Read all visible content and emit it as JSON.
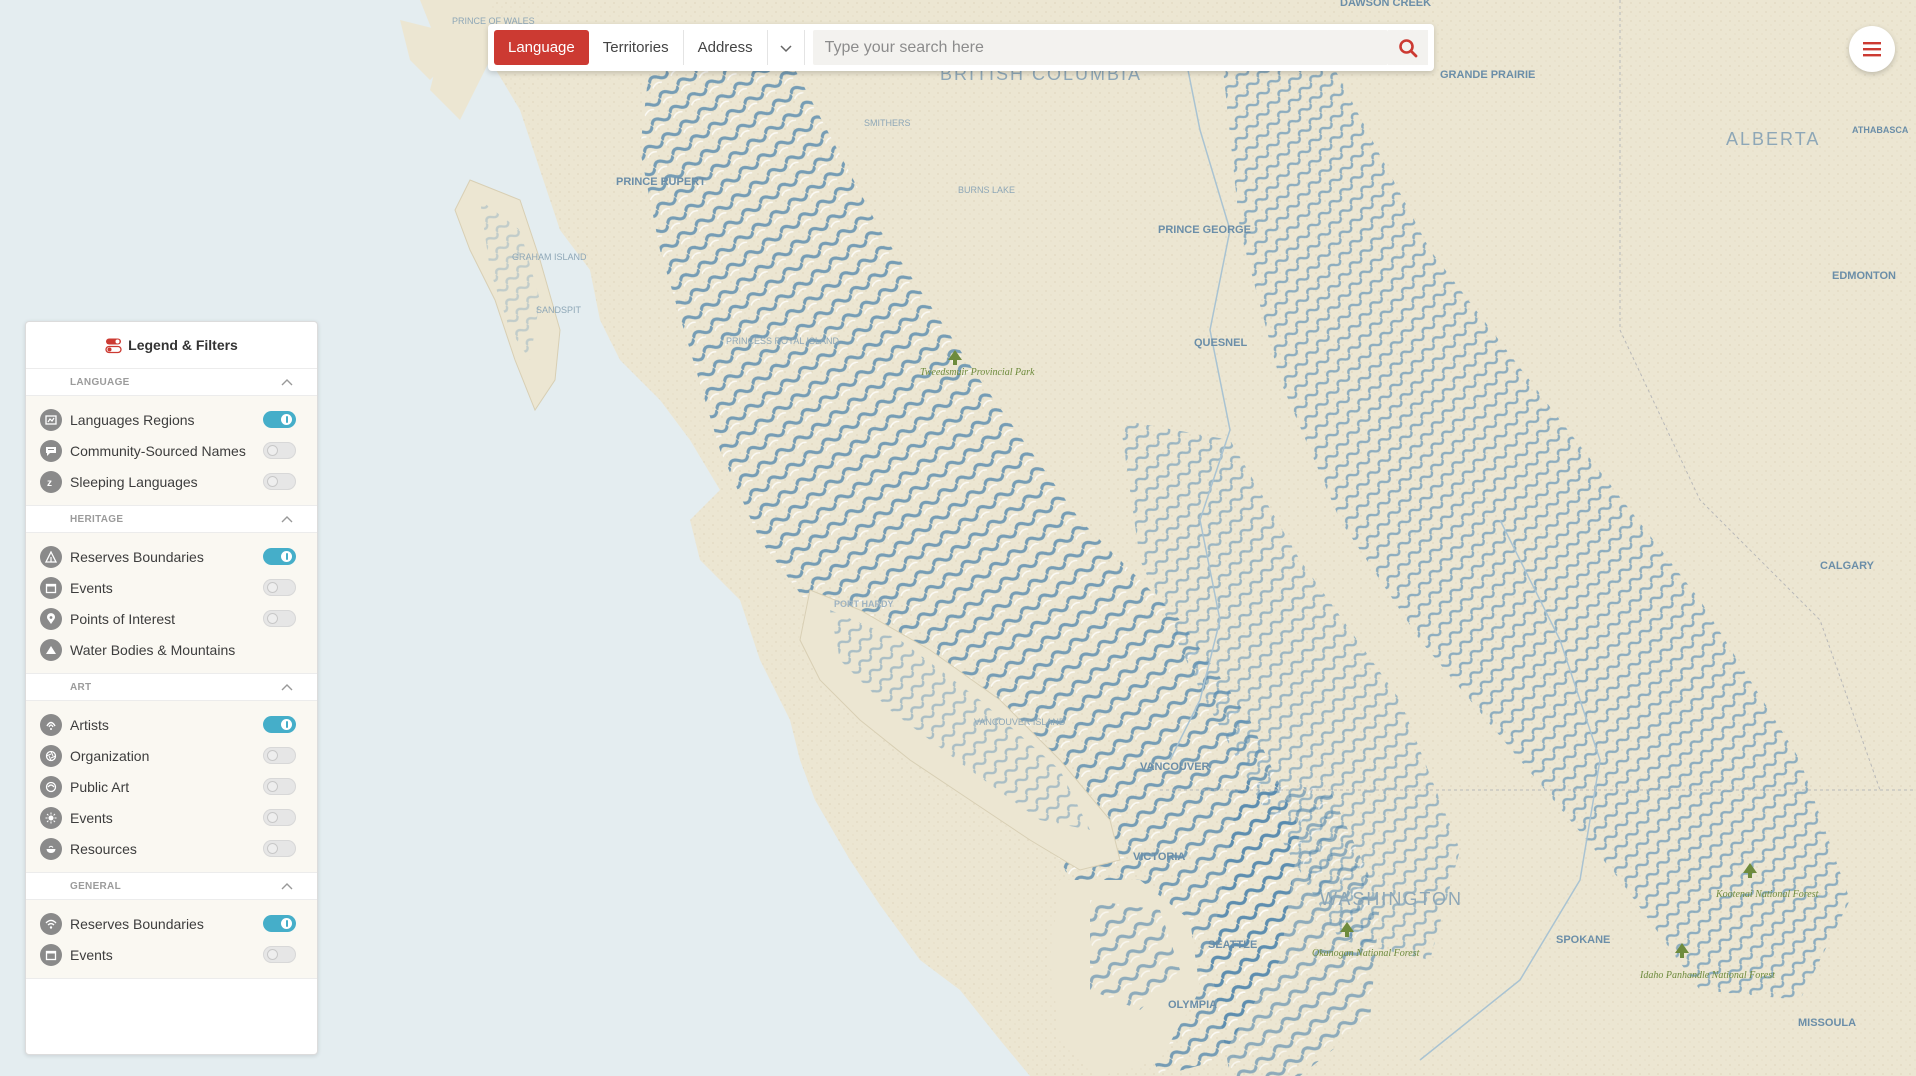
{
  "search": {
    "tabs": [
      {
        "label": "Language",
        "active": true
      },
      {
        "label": "Territories",
        "active": false
      },
      {
        "label": "Address",
        "active": false
      }
    ],
    "placeholder": "Type your search here",
    "more_icon": "chevron-down-icon",
    "search_icon": "search-icon"
  },
  "menu": {
    "icon": "hamburger-menu-icon"
  },
  "legend": {
    "title": "Legend & Filters",
    "icon": "toggle-switch-icon",
    "sections": [
      {
        "title": "LANGUAGE",
        "items": [
          {
            "label": "Languages Regions",
            "icon": "map-region-icon",
            "toggle": true
          },
          {
            "label": "Community-Sourced Names",
            "icon": "chat-bubble-icon",
            "toggle": false
          },
          {
            "label": "Sleeping Languages",
            "icon": "sleep-icon",
            "toggle": false
          }
        ]
      },
      {
        "title": "HERITAGE",
        "items": [
          {
            "label": "Reserves Boundaries",
            "icon": "tent-icon",
            "toggle": true
          },
          {
            "label": "Events",
            "icon": "calendar-icon",
            "toggle": false
          },
          {
            "label": "Points of Interest",
            "icon": "pin-icon",
            "toggle": false
          },
          {
            "label": "Water Bodies & Mountains",
            "icon": "mountain-icon",
            "toggle": null
          }
        ]
      },
      {
        "title": "ART",
        "items": [
          {
            "label": "Artists",
            "icon": "artist-icon",
            "toggle": true
          },
          {
            "label": "Organization",
            "icon": "aperture-icon",
            "toggle": false
          },
          {
            "label": "Public Art",
            "icon": "public-art-icon",
            "toggle": false
          },
          {
            "label": "Events",
            "icon": "sun-icon",
            "toggle": false
          },
          {
            "label": "Resources",
            "icon": "bowl-icon",
            "toggle": false
          }
        ]
      },
      {
        "title": "GENERAL",
        "items": [
          {
            "label": "Reserves Boundaries",
            "icon": "wifi-icon",
            "toggle": true
          },
          {
            "label": "Events",
            "icon": "calendar-icon",
            "toggle": false
          }
        ]
      }
    ]
  },
  "map": {
    "region_labels": [
      {
        "text": "BRITISH COLUMBIA",
        "big": true
      },
      {
        "text": "ALBERTA",
        "big": true
      },
      {
        "text": "WASHINGTON",
        "big": true
      }
    ],
    "city_labels": [
      "PRINCE RUPERT",
      "PRINCE GEORGE",
      "QUESNEL",
      "VANCOUVER",
      "VICTORIA",
      "SEATTLE",
      "OLYMPIA",
      "SPOKANE",
      "CALGARY",
      "EDMONTON",
      "GRANDE PRAIRIE",
      "PORT HARDY",
      "ATHABASCA",
      "MISSOULA",
      "DAWSON CREEK"
    ],
    "island_labels": [
      "GRAHAM ISLAND",
      "PRINCESS ROYAL ISLAND",
      "VANCOUVER ISLAND",
      "SANDSPIT",
      "BURNS LAKE",
      "SMITHERS",
      "PRINCE OF WALES"
    ],
    "parks": [
      "Tweedsmuir Provincial Park",
      "Okanogan National Forest",
      "Kootenai National Forest",
      "Idaho Panhandle National Forest"
    ],
    "colors": {
      "ocean": "#e4edf0",
      "land": "#ece6d2",
      "mountain": "#5c8fb3",
      "label": "#6b8ea8",
      "park": "#6e8b3d"
    }
  }
}
